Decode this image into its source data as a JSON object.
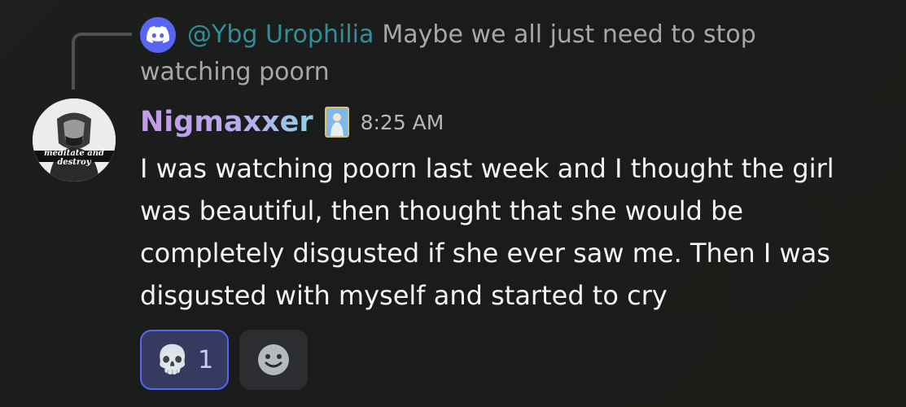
{
  "reply": {
    "username": "@Ybg Urophilia",
    "text": "Maybe we all just need to stop watching poorn",
    "avatar_icon": "discord-logo-icon",
    "avatar_color": "#5865f2"
  },
  "message": {
    "username": "Nigmaxxer",
    "role_icon": "role-badge-icon",
    "timestamp": "8:25 AM",
    "text": "I was watching poorn last week and I thought the girl was beautiful, then thought that she would be completely disgusted if she ever saw me. Then I was disgusted with myself and started to cry",
    "avatar_caption": "meditate and destroy"
  },
  "reactions": [
    {
      "emoji": "💀",
      "count": "1",
      "active": true
    }
  ],
  "add_reaction_icon": "smiley-face-icon",
  "colors": {
    "accent": "#5865f2",
    "reply_name": "#2f8f98",
    "background": "#1c1d1b"
  }
}
